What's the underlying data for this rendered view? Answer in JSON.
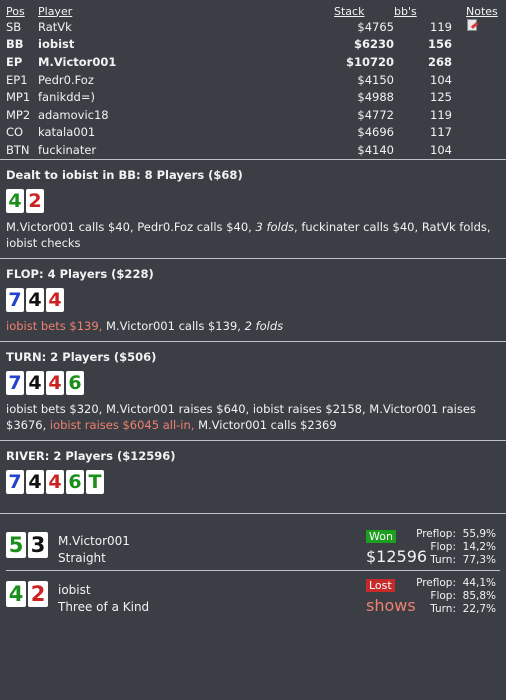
{
  "columns": {
    "pos": "Pos",
    "player": "Player",
    "stack": "Stack",
    "bbs": "bb's",
    "notes": "Notes"
  },
  "players": [
    {
      "pos": "SB",
      "name": "RatVk",
      "stack": "$4765",
      "bbs": "119",
      "bold": false,
      "note": true
    },
    {
      "pos": "BB",
      "name": "iobist",
      "stack": "$6230",
      "bbs": "156",
      "bold": true,
      "note": false
    },
    {
      "pos": "EP",
      "name": "M.Victor001",
      "stack": "$10720",
      "bbs": "268",
      "bold": true,
      "note": false
    },
    {
      "pos": "EP1",
      "name": "Pedr0.Foz",
      "stack": "$4150",
      "bbs": "104",
      "bold": false,
      "note": false
    },
    {
      "pos": "MP1",
      "name": "fanikdd=)",
      "stack": "$4988",
      "bbs": "125",
      "bold": false,
      "note": false
    },
    {
      "pos": "MP2",
      "name": "adamovic18",
      "stack": "$4772",
      "bbs": "119",
      "bold": false,
      "note": false
    },
    {
      "pos": "CO",
      "name": "katala001",
      "stack": "$4696",
      "bbs": "117",
      "bold": false,
      "note": false
    },
    {
      "pos": "BTN",
      "name": "fuckinater",
      "stack": "$4140",
      "bbs": "104",
      "bold": false,
      "note": false
    }
  ],
  "preflop": {
    "title": "Dealt to iobist in BB: 8 Players ($68)",
    "cards": [
      {
        "r": "4",
        "s": "s"
      },
      {
        "r": "2",
        "s": "h"
      }
    ],
    "a1": "M.Victor001 calls $40, Pedr0.Foz calls $40, ",
    "a2": "3 folds",
    "a3": ", fuckinater calls $40, RatVk folds, iobist checks"
  },
  "flop": {
    "title": "FLOP: 4 Players ($228)",
    "cards": [
      {
        "r": "7",
        "s": "d"
      },
      {
        "r": "4",
        "s": "k"
      },
      {
        "r": "4",
        "s": "h"
      }
    ],
    "a1": "iobist bets $139,",
    "a2": " M.Victor001 calls $139, ",
    "a3": "2 folds"
  },
  "turn": {
    "title": "TURN: 2 Players ($506)",
    "cards": [
      {
        "r": "7",
        "s": "d"
      },
      {
        "r": "4",
        "s": "k"
      },
      {
        "r": "4",
        "s": "h"
      },
      {
        "r": "6",
        "s": "s"
      }
    ],
    "a1": "iobist bets $320, M.Victor001 raises $640, iobist raises $2158, M.Victor001 raises $3676, ",
    "a2": "iobist raises $6045 all-in,",
    "a3": " M.Victor001 calls $2369"
  },
  "river": {
    "title": "RIVER: 2 Players ($12596)",
    "cards": [
      {
        "r": "7",
        "s": "d"
      },
      {
        "r": "4",
        "s": "k"
      },
      {
        "r": "4",
        "s": "h"
      },
      {
        "r": "6",
        "s": "s"
      },
      {
        "r": "T",
        "s": "s"
      }
    ]
  },
  "results": [
    {
      "cards": [
        {
          "r": "5",
          "s": "s"
        },
        {
          "r": "3",
          "s": "k"
        }
      ],
      "name": "M.Victor001",
      "hand": "Straight",
      "badge": "Won",
      "badge_type": "won",
      "amount": "$12596",
      "eq": [
        {
          "l": "Preflop:",
          "v": "55,9%"
        },
        {
          "l": "Flop:",
          "v": "14,2%"
        },
        {
          "l": "Turn:",
          "v": "77,3%"
        }
      ]
    },
    {
      "cards": [
        {
          "r": "4",
          "s": "s"
        },
        {
          "r": "2",
          "s": "h"
        }
      ],
      "name": "iobist",
      "hand": "Three of a Kind",
      "badge": "Lost",
      "badge_type": "lost",
      "amount": "shows",
      "eq": [
        {
          "l": "Preflop:",
          "v": "44,1%"
        },
        {
          "l": "Flop:",
          "v": "85,8%"
        },
        {
          "l": "Turn:",
          "v": "22,7%"
        }
      ]
    }
  ],
  "colors": {
    "background": "#3b3f45",
    "hero_action": "#f08070",
    "won": "#1e9e1e",
    "lost": "#c62a2a"
  }
}
